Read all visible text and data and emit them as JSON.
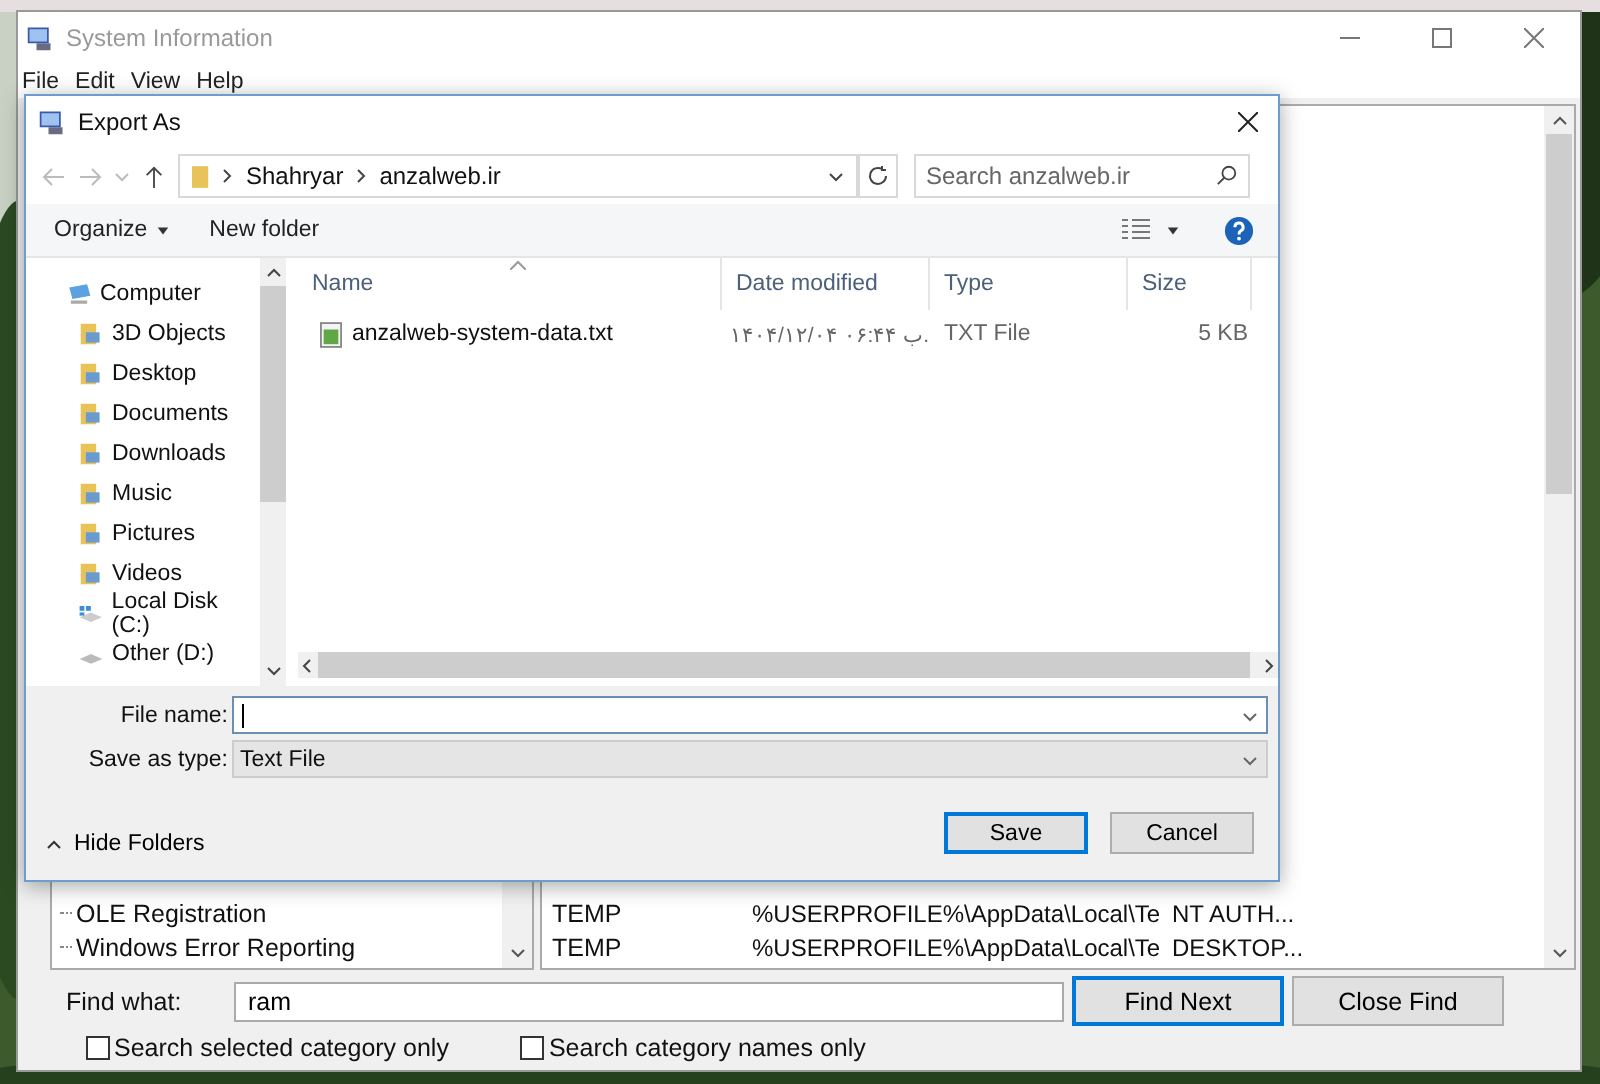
{
  "main_window": {
    "title": "System Information",
    "menu": [
      "File",
      "Edit",
      "View",
      "Help"
    ],
    "tree_items": [
      {
        "label": "OLE Registration"
      },
      {
        "label": "Windows Error Reporting"
      }
    ],
    "rows": [
      [
        "TEMP",
        "%USERPROFILE%\\AppData\\Local\\Te",
        "NT AUTH..."
      ],
      [
        "TEMP",
        "%USERPROFILE%\\AppData\\Local\\Te",
        "DESKTOP..."
      ]
    ],
    "find": {
      "label": "Find what:",
      "value": "ram",
      "buttons": [
        {
          "label": "Find Next",
          "default": true
        },
        {
          "label": "Close Find",
          "default": false
        }
      ],
      "options": [
        {
          "label": "Search selected category only",
          "checked": false
        },
        {
          "label": "Search category names only",
          "checked": false
        }
      ]
    }
  },
  "dialog": {
    "title": "Export As",
    "breadcrumb": [
      "Shahryar",
      "anzalweb.ir"
    ],
    "search": {
      "placeholder": "Search anzalweb.ir"
    },
    "toolbar": [
      {
        "label": "Organize",
        "dropdown": true
      },
      {
        "label": "New folder",
        "dropdown": false
      }
    ],
    "nav": [
      {
        "label": "Computer",
        "kind": "computer",
        "children": [
          {
            "label": "3D Objects",
            "kind": "folder"
          },
          {
            "label": "Desktop",
            "kind": "folder"
          },
          {
            "label": "Documents",
            "kind": "folder"
          },
          {
            "label": "Downloads",
            "kind": "folder"
          },
          {
            "label": "Music",
            "kind": "folder"
          },
          {
            "label": "Pictures",
            "kind": "folder"
          },
          {
            "label": "Videos",
            "kind": "folder"
          },
          {
            "label": "Local Disk (C:)",
            "kind": "disk"
          },
          {
            "label": "Other (D:)",
            "kind": "drive"
          }
        ]
      }
    ],
    "columns": [
      "Name",
      "Date modified",
      "Type",
      "Size"
    ],
    "files": [
      {
        "name": "anzalweb-system-data.txt",
        "date": "۱۴۰۴/۱۲/۰۴ ب ۰۶:۴۴.",
        "type": "TXT File",
        "size": "5 KB"
      }
    ],
    "file_name": {
      "label": "File name:"
    },
    "save_type": {
      "label": "Save as type:",
      "value": "Text File"
    },
    "hide_folders": "Hide Folders",
    "buttons": [
      {
        "label": "Save",
        "default": true
      },
      {
        "label": "Cancel",
        "default": false
      }
    ]
  }
}
